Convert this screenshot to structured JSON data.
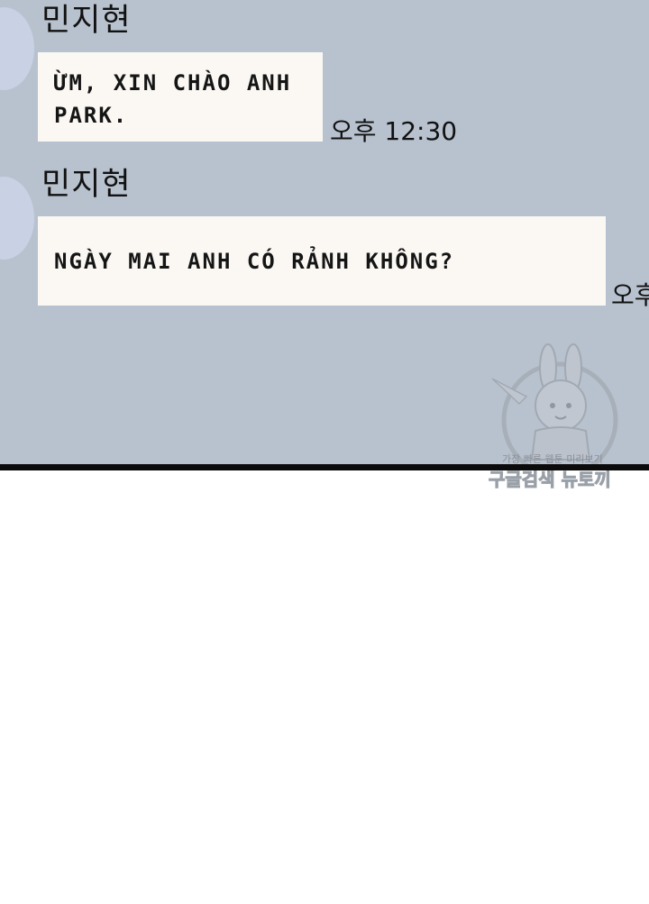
{
  "messages": [
    {
      "sender": "민지현",
      "text": "ỪM, XIN CHÀO ANH PARK.",
      "time": "오후 12:30"
    },
    {
      "sender": "민지현",
      "text": "NGÀY MAI ANH CÓ RẢNH KHÔNG?",
      "time": "오후"
    }
  ],
  "watermark": {
    "line1": "가장 빠른 웹툰 미리보기",
    "line2": "구글검색 뉴토끼"
  },
  "colors": {
    "chat_background": "#b8c2cf",
    "bubble": "#fbf8f4",
    "avatar": "#c9d1e4",
    "divider": "#0b0b0b",
    "page_background": "#ffffff"
  }
}
